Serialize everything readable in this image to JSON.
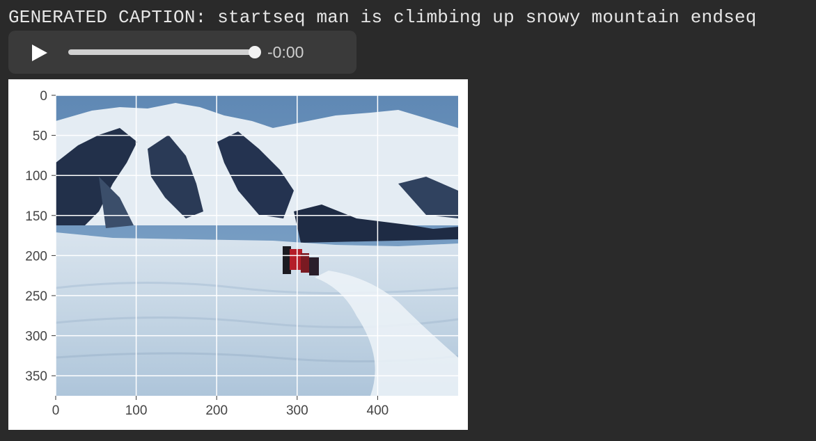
{
  "caption": {
    "text": "GENERATED CAPTION: startseq man is climbing up snowy mountain endseq"
  },
  "audio_player": {
    "time_display": "-0:00",
    "progress": 1.0,
    "play_icon": "play-icon"
  },
  "chart_data": {
    "type": "image",
    "x_ticks": [
      "0",
      "100",
      "200",
      "300",
      "400"
    ],
    "y_ticks": [
      "0",
      "50",
      "100",
      "150",
      "200",
      "250",
      "300",
      "350"
    ],
    "x_tick_values": [
      0,
      100,
      200,
      300,
      400
    ],
    "y_tick_values": [
      0,
      50,
      100,
      150,
      200,
      250,
      300,
      350
    ],
    "xlim": [
      0,
      500
    ],
    "ylim": [
      375,
      0
    ],
    "grid": true
  },
  "colors": {
    "background": "#2a2a2a",
    "sky": "#6f9ac4",
    "snow": "#dbe6f0",
    "rock": "#1e2a3a",
    "climber": "#b41e28"
  }
}
